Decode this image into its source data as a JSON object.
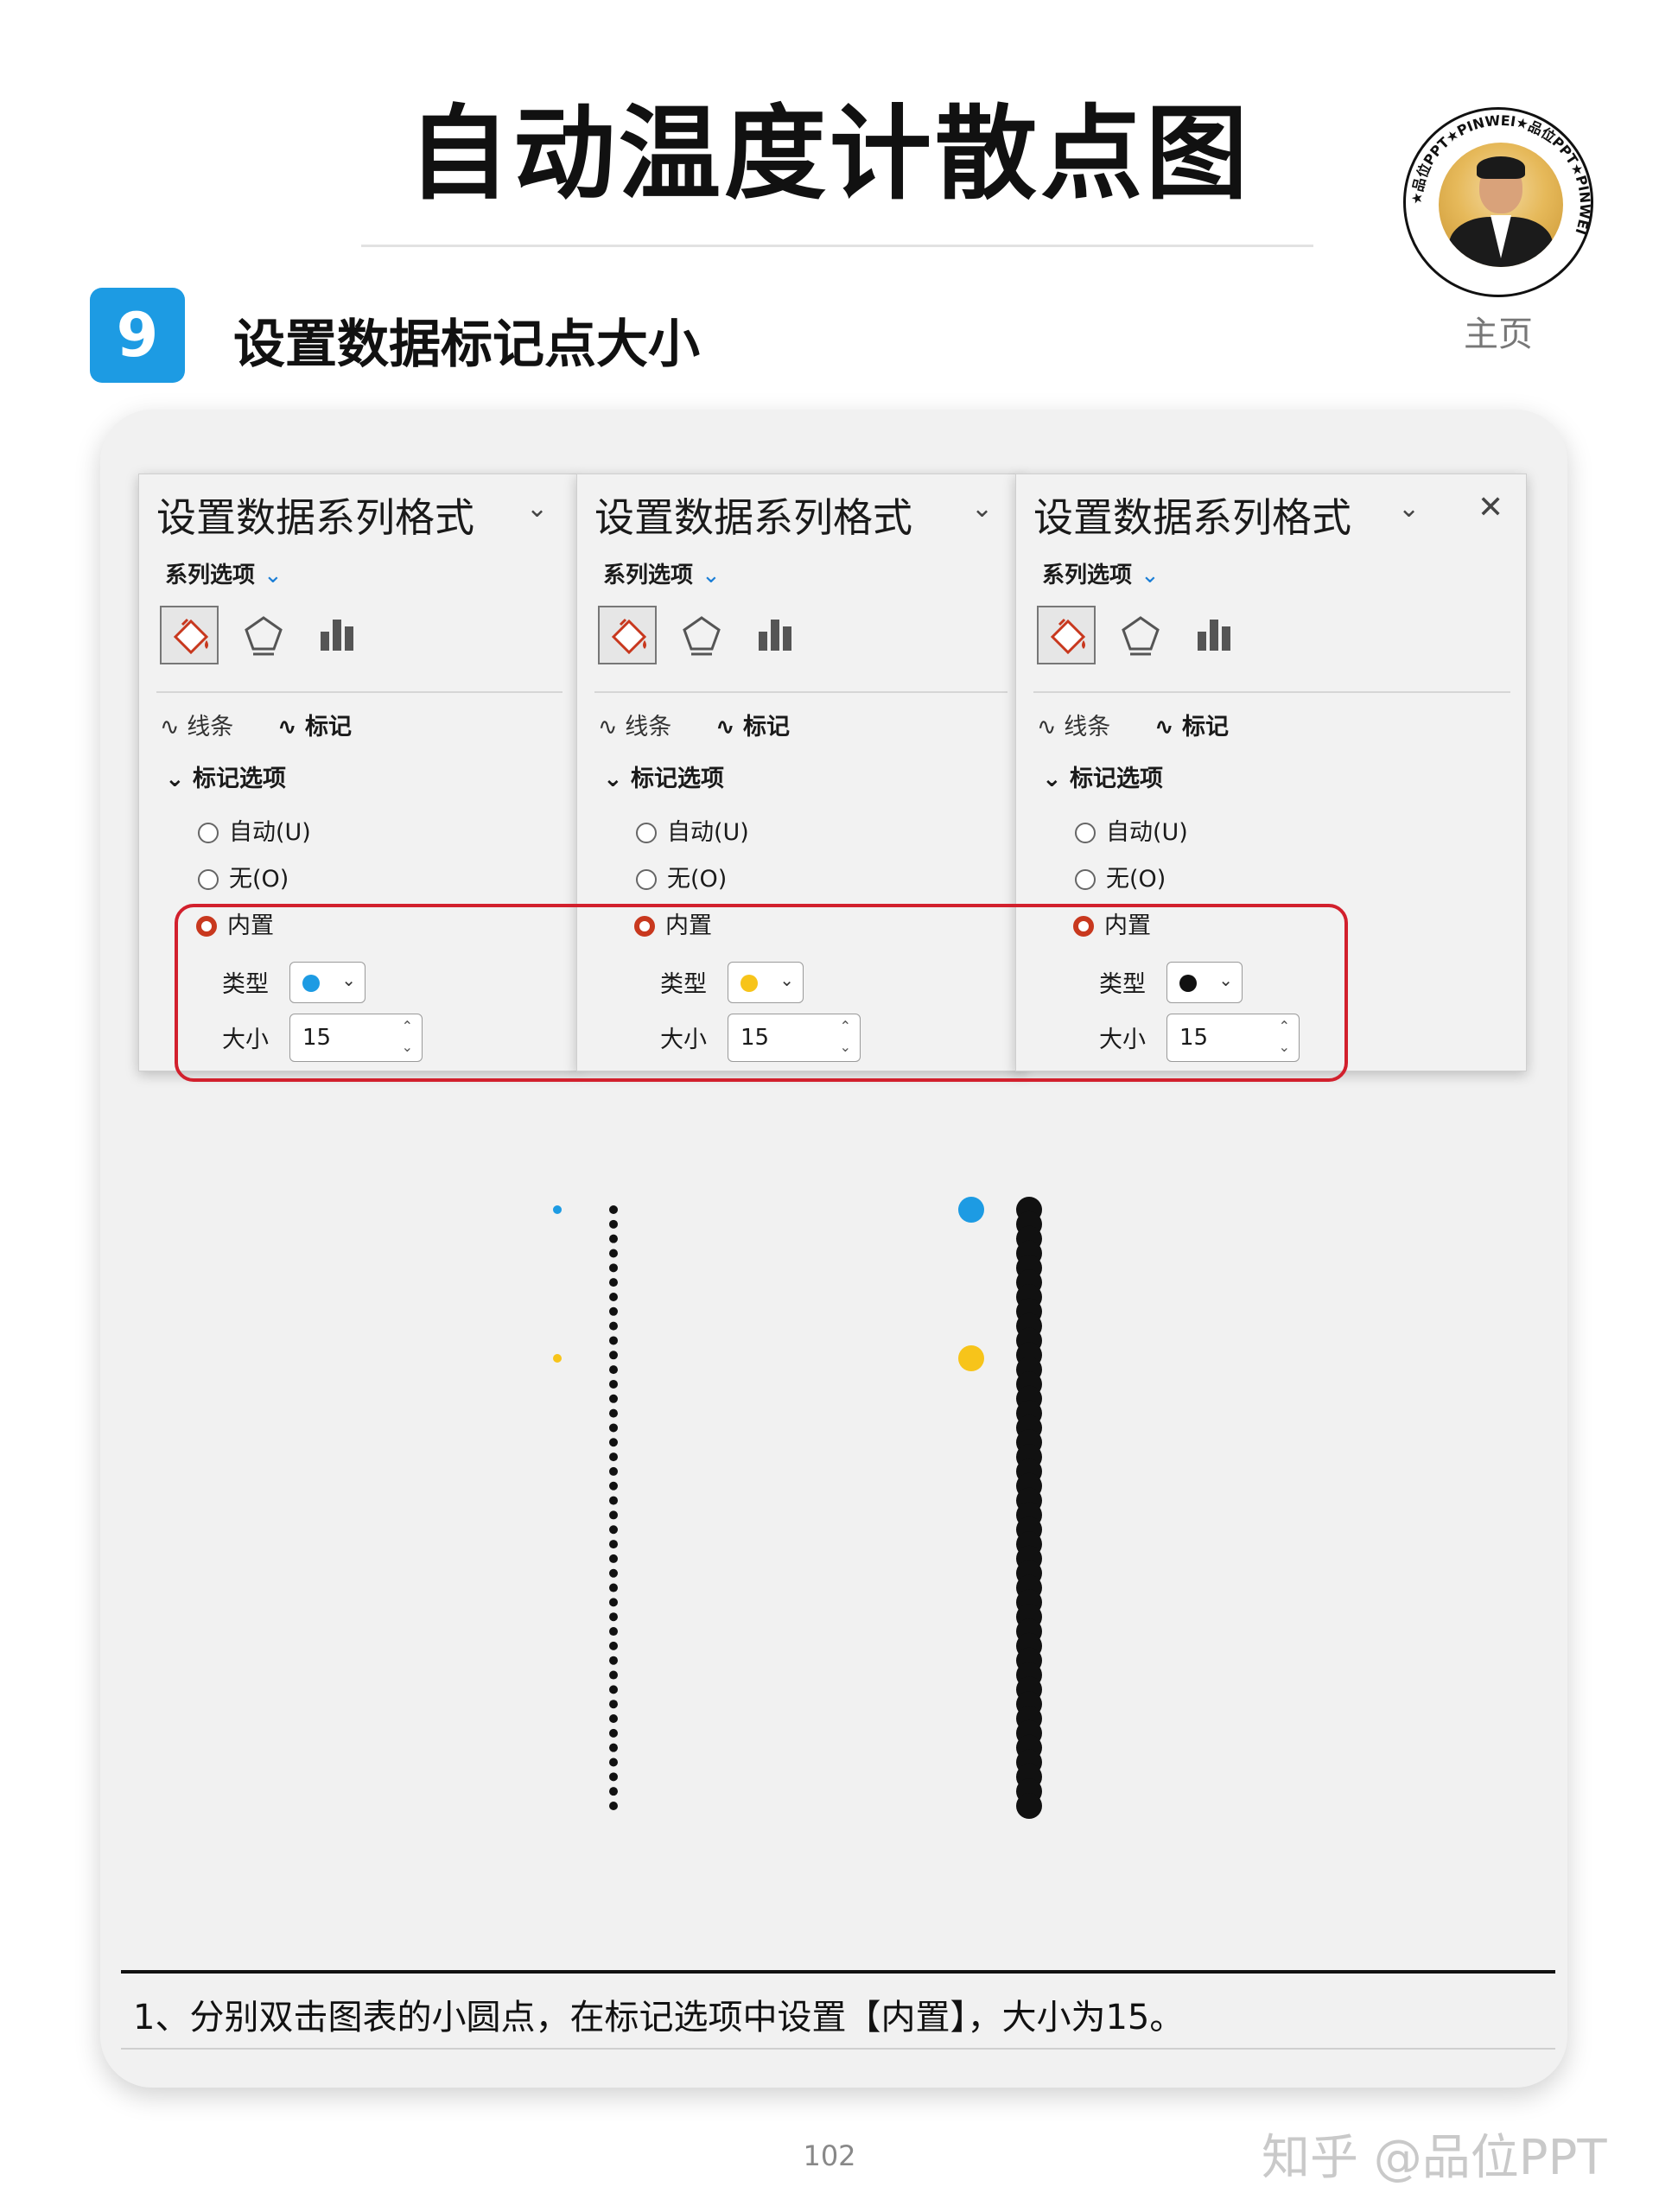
{
  "page": {
    "title": "自动温度计散点图",
    "home_label": "主页",
    "step_number": "9",
    "step_title": "设置数据标记点大小",
    "caption": "1、分别双击图表的小圆点，在标记选项中设置【内置】，大小为15。",
    "page_number": "102",
    "watermark": "知乎 @品位PPT"
  },
  "logo": {
    "ring_text": "★品位PPT★PINWEI★品位PPT★PINWEI",
    "colors": {
      "ring": "#111111",
      "portrait_bg": "#e6b95a"
    }
  },
  "panels": [
    {
      "title": "设置数据系列格式",
      "series_options": "系列选项",
      "tabs": [
        "线条",
        "标记"
      ],
      "section": "标记选项",
      "radios": [
        "自动(U)",
        "无(O)",
        "内置"
      ],
      "selected_radio": "内置",
      "type_label": "类型",
      "size_label": "大小",
      "size_value": "15",
      "marker_color": "#1d9be3",
      "has_close": false
    },
    {
      "title": "设置数据系列格式",
      "series_options": "系列选项",
      "tabs": [
        "线条",
        "标记"
      ],
      "section": "标记选项",
      "radios": [
        "自动(U)",
        "无(O)",
        "内置"
      ],
      "selected_radio": "内置",
      "type_label": "类型",
      "size_label": "大小",
      "size_value": "15",
      "marker_color": "#f7c41a",
      "has_close": false
    },
    {
      "title": "设置数据系列格式",
      "series_options": "系列选项",
      "tabs": [
        "线条",
        "标记"
      ],
      "section": "标记选项",
      "radios": [
        "自动(U)",
        "无(O)",
        "内置"
      ],
      "selected_radio": "内置",
      "type_label": "类型",
      "size_label": "大小",
      "size_value": "15",
      "marker_color": "#111111",
      "has_close": true
    }
  ],
  "icons": [
    "paint-bucket-icon",
    "pentagon-icon",
    "bar-chart-icon",
    "line-icon",
    "marker-line-icon",
    "chevron-down-icon",
    "close-icon",
    "spin-up-icon",
    "spin-down-icon"
  ],
  "colors": {
    "accent_blue": "#1d9be3",
    "accent_yellow": "#f7c41a",
    "marker_black": "#111111",
    "highlight_red": "#d2202d",
    "radio_checked": "#c8381e"
  },
  "plots": {
    "before": {
      "blue_point": {
        "marker_size": "small"
      },
      "yellow_point": {
        "marker_size": "small"
      },
      "column_marker_size": "small",
      "column_point_count": 42
    },
    "after": {
      "blue_point": {
        "marker_size": 15
      },
      "yellow_point": {
        "marker_size": 15
      },
      "column_marker_size": 15,
      "column_point_count": 42
    }
  }
}
